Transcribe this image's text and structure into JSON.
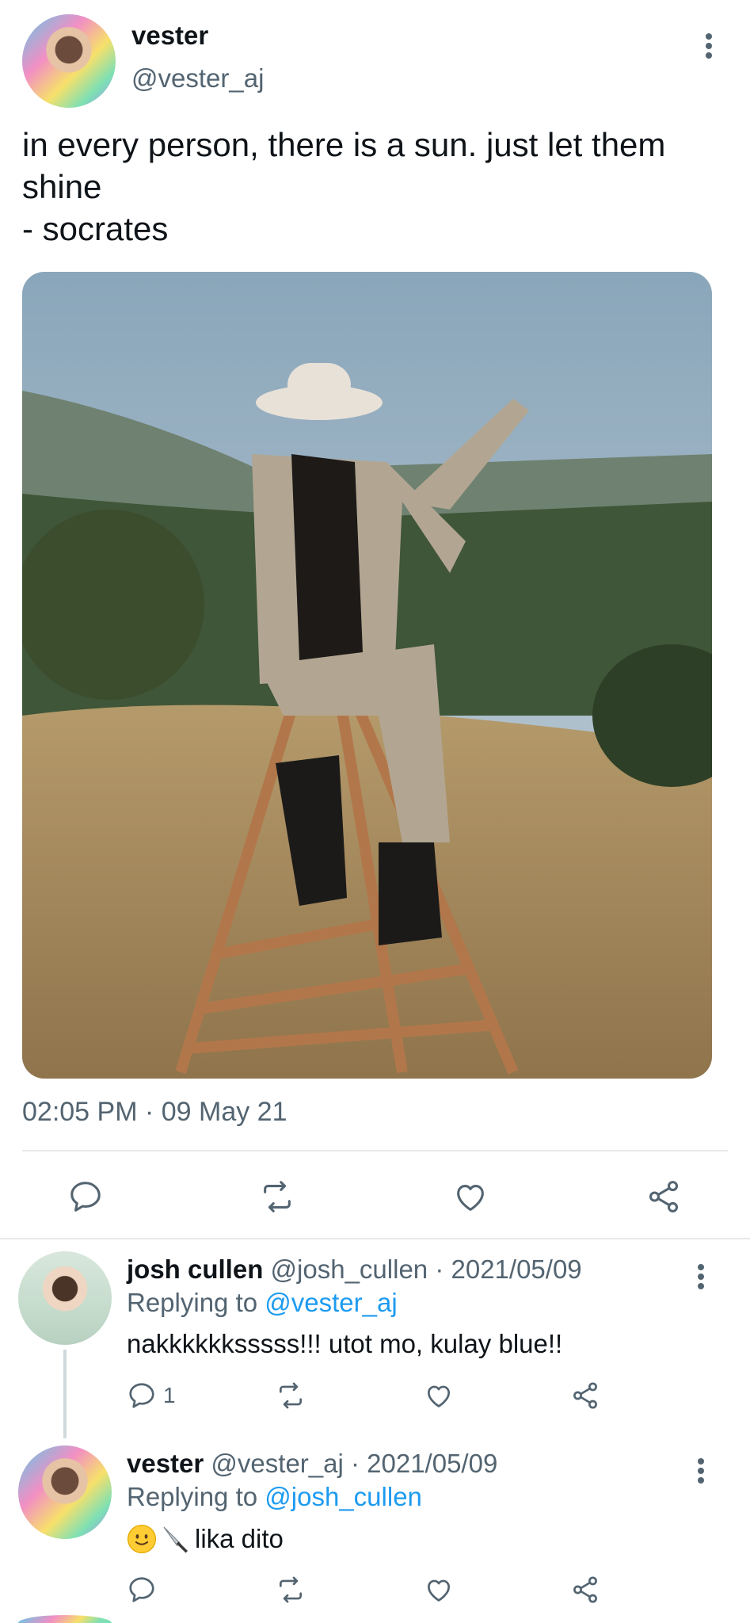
{
  "main_tweet": {
    "author_name": "vester",
    "author_handle": "@vester_aj",
    "text": "in every person, there is a sun. just let them shine\n- socrates",
    "timestamp": "02:05 PM · 09 May 21",
    "media_description_icon": "photo"
  },
  "replies": [
    {
      "author_name": "josh cullen",
      "meta": "@josh_cullen · 2021/05/09",
      "replying_prefix": "Replying to",
      "replying_to": "@vester_aj",
      "text": "nakkkkkksssss!!! utot mo, kulay blue!!",
      "reply_count": "1"
    },
    {
      "author_name": "vester",
      "meta": "@vester_aj · 2021/05/09",
      "replying_prefix": "Replying to",
      "replying_to": "@josh_cullen",
      "text": "lika dito",
      "emoji": [
        "slightly-smiling-face",
        "kitchen-knife"
      ]
    }
  ],
  "colors": {
    "text_primary": "#0f1419",
    "text_secondary": "#536471",
    "link": "#1d9bf0",
    "divider": "#e6e9ec"
  }
}
